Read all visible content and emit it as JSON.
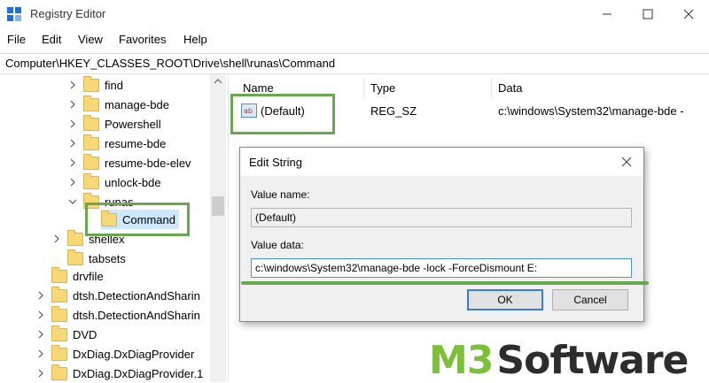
{
  "window": {
    "title": "Registry Editor"
  },
  "menu": [
    "File",
    "Edit",
    "View",
    "Favorites",
    "Help"
  ],
  "address": "Computer\\HKEY_CLASSES_ROOT\\Drive\\shell\\runas\\Command",
  "tree": {
    "items": [
      {
        "label": "find"
      },
      {
        "label": "manage-bde"
      },
      {
        "label": "Powershell"
      },
      {
        "label": "resume-bde"
      },
      {
        "label": "resume-bde-elev"
      },
      {
        "label": "unlock-bde"
      },
      {
        "label": "runas"
      },
      {
        "label": "Command"
      },
      {
        "label": "shellex"
      },
      {
        "label": "tabsets"
      },
      {
        "label": "drvfile"
      },
      {
        "label": "dtsh.DetectionAndSharin"
      },
      {
        "label": "dtsh.DetectionAndSharin"
      },
      {
        "label": "DVD"
      },
      {
        "label": "DxDiag.DxDiagProvider"
      },
      {
        "label": "DxDiag.DxDiagProvider.1"
      }
    ]
  },
  "list": {
    "headers": {
      "name": "Name",
      "type": "Type",
      "data": "Data"
    },
    "rows": [
      {
        "name": "(Default)",
        "type": "REG_SZ",
        "data": "c:\\windows\\System32\\manage-bde -",
        "icon": "ab"
      }
    ]
  },
  "dialog": {
    "title": "Edit String",
    "value_name_label": "Value name:",
    "value_name": "(Default)",
    "value_data_label": "Value data:",
    "value_data": "c:\\windows\\System32\\manage-bde -lock -ForceDismount E:",
    "ok": "OK",
    "cancel": "Cancel"
  },
  "watermark": {
    "prefix": "M3",
    "suffix": "Software"
  },
  "colors": {
    "accent_green": "#6aa84f",
    "brand_green": "#7cbf3a"
  }
}
